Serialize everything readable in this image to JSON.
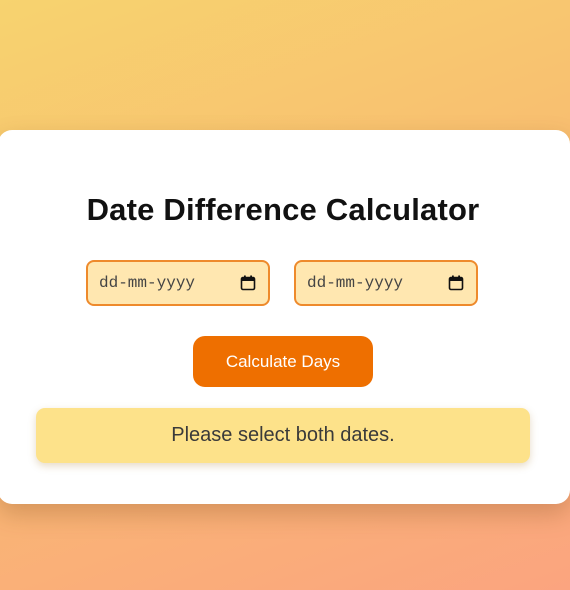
{
  "calculator": {
    "title": "Date Difference Calculator",
    "start_date": {
      "placeholder": "dd-mm-yyyy",
      "value": ""
    },
    "end_date": {
      "placeholder": "dd-mm-yyyy",
      "value": ""
    },
    "calculate_label": "Calculate Days",
    "result_message": "Please select both dates."
  },
  "colors": {
    "accent": "#ee6f00",
    "input_background": "#ffe7b0",
    "input_border": "#ee8a2c",
    "result_background": "#fde28a"
  },
  "icons": {
    "date_picker": "calendar-icon"
  }
}
